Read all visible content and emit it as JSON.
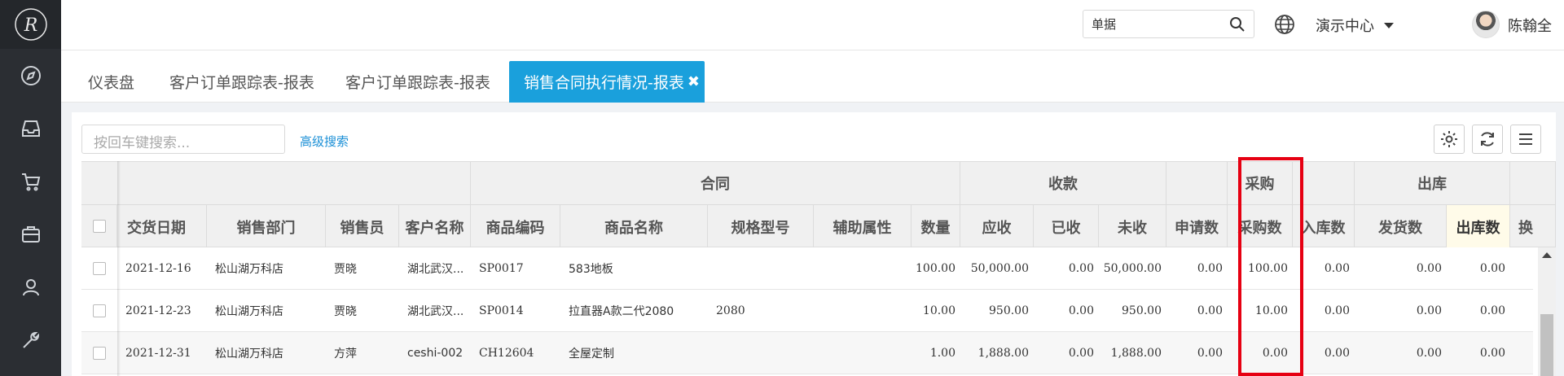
{
  "header": {
    "search_value": "单据",
    "center_label": "演示中心",
    "user_name": "陈翰全"
  },
  "tabs": [
    {
      "label": "仪表盘"
    },
    {
      "label": "客户订单跟踪表-报表"
    },
    {
      "label": "客户订单跟踪表-报表"
    },
    {
      "label": "销售合同执行情况-报表",
      "close": "✖"
    }
  ],
  "toolbar": {
    "keyword_placeholder": "按回车键搜索...",
    "advanced_search": "高级搜索"
  },
  "table": {
    "groups": {
      "contract": "合同",
      "receipt": "收款",
      "purchase": "采购",
      "outbound": "出库"
    },
    "columns": [
      "交货日期",
      "销售部门",
      "销售员",
      "客户名称",
      "商品编码",
      "商品名称",
      "规格型号",
      "辅助属性",
      "数量",
      "应收",
      "已收",
      "未收",
      "申请数",
      "采购数",
      "入库数",
      "发货数",
      "出库数",
      "换"
    ],
    "rows": [
      [
        "2021-12-16",
        "松山湖万科店",
        "贾晓",
        "湖北武汉...",
        "SP0017",
        "583地板",
        "",
        "",
        "100.00",
        "50,000.00",
        "0.00",
        "50,000.00",
        "0.00",
        "100.00",
        "0.00",
        "0.00",
        "0.00"
      ],
      [
        "2021-12-23",
        "松山湖万科店",
        "贾晓",
        "湖北武汉...",
        "SP0014",
        "拉直器A款二代2080",
        "2080",
        "",
        "10.00",
        "950.00",
        "0.00",
        "950.00",
        "0.00",
        "10.00",
        "0.00",
        "0.00",
        "0.00"
      ],
      [
        "2021-12-31",
        "松山湖万科店",
        "方萍",
        "ceshi-002",
        "CH12604",
        "全屋定制",
        "",
        "",
        "1.00",
        "1,888.00",
        "0.00",
        "1,888.00",
        "0.00",
        "0.00",
        "0.00",
        "0.00",
        "0.00"
      ]
    ]
  },
  "colors": {
    "accent": "#1aa0dc",
    "highlight": "#e60012",
    "sidebar": "#2b2e33"
  }
}
